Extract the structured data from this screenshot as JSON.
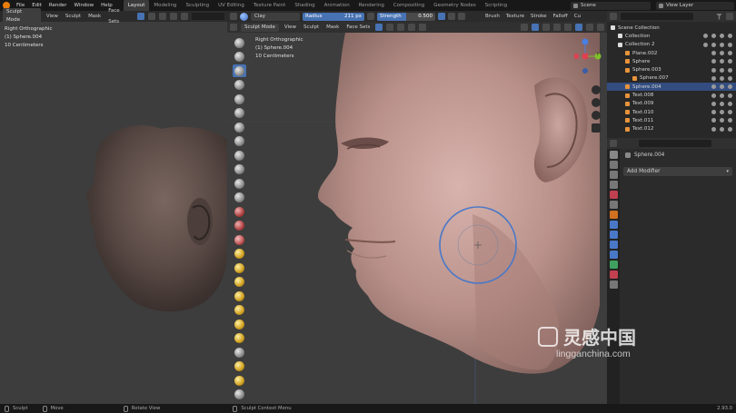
{
  "menus": [
    "File",
    "Edit",
    "Render",
    "Window",
    "Help"
  ],
  "workspaces": [
    "Layout",
    "Modeling",
    "Sculpting",
    "UV Editing",
    "Texture Paint",
    "Shading",
    "Animation",
    "Rendering",
    "Compositing",
    "Geometry Nodes",
    "Scripting"
  ],
  "scene": {
    "scene_name": "Scene",
    "view_layer": "View Layer"
  },
  "left_viewport": {
    "mode": "Sculpt Mode",
    "menus": [
      "View",
      "Sculpt",
      "Mask",
      "Face Sets"
    ],
    "overlay_lines": [
      "Right Orthographic",
      "(1) Sphere.004",
      "10 Centimeters"
    ]
  },
  "tool_header": {
    "brush": "Clay",
    "radius_label": "Radius",
    "radius_value": "211 px",
    "strength_label": "Strength",
    "strength_value": "0.500",
    "menus": [
      "Brush",
      "Texture",
      "Stroke",
      "Falloff",
      "Cu"
    ]
  },
  "right_viewport": {
    "mode": "Sculpt Mode",
    "menus": [
      "View",
      "Sculpt",
      "Mask",
      "Face Sets"
    ],
    "overlay_lines": [
      "Right Orthographic",
      "(1) Sphere.004",
      "10 Centimeters"
    ]
  },
  "gizmo": {
    "x": "X",
    "y": "Y",
    "z": "Z"
  },
  "outliner": {
    "search_placeholder": "",
    "rows": [
      {
        "label": "Scene Collection",
        "indent": 0,
        "selected": false
      },
      {
        "label": "Collection",
        "indent": 1,
        "selected": false
      },
      {
        "label": "Collection 2",
        "indent": 1,
        "selected": false
      },
      {
        "label": "Plane.002",
        "indent": 2,
        "selected": false
      },
      {
        "label": "Sphere",
        "indent": 2,
        "selected": false
      },
      {
        "label": "Sphere.003",
        "indent": 2,
        "selected": false
      },
      {
        "label": "Sphere.007",
        "indent": 3,
        "selected": false
      },
      {
        "label": "Sphere.004",
        "indent": 2,
        "selected": true
      },
      {
        "label": "Text.008",
        "indent": 2,
        "selected": false
      },
      {
        "label": "Text.009",
        "indent": 2,
        "selected": false
      },
      {
        "label": "Text.010",
        "indent": 2,
        "selected": false
      },
      {
        "label": "Text.011",
        "indent": 2,
        "selected": false
      },
      {
        "label": "Text.012",
        "indent": 2,
        "selected": false
      }
    ]
  },
  "properties": {
    "object_name": "Sphere.004",
    "add_modifier": "Add Modifier"
  },
  "status": {
    "sculpt": "Sculpt",
    "move": "Move",
    "rotate": "Rotate View",
    "context": "Sculpt Context Menu",
    "version": "2.93.0"
  },
  "watermark": {
    "brand": "灵感中国",
    "url": "lingganchina.com"
  },
  "colors": {
    "accent": "#4772b3",
    "selected_row": "#334d80",
    "brush_circle": "#4a78c8"
  }
}
